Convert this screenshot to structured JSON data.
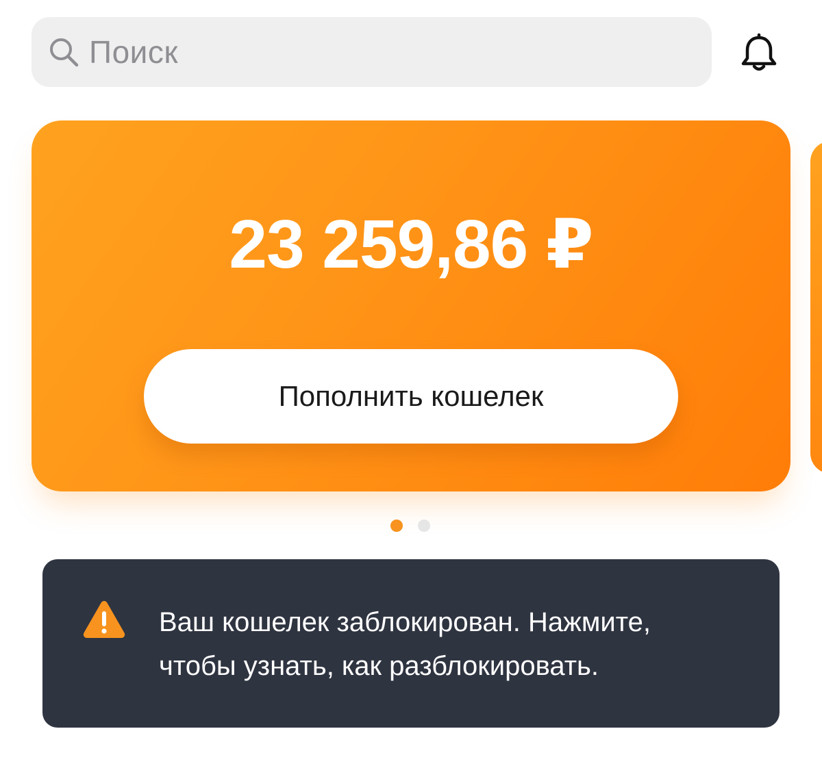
{
  "search": {
    "placeholder": "Поиск",
    "icon": "search-icon"
  },
  "header": {
    "notifications_icon": "bell-icon"
  },
  "wallet": {
    "balance": "23 259,86 ₽",
    "topup_label": "Пополнить кошелек",
    "card_color": "#ff9518"
  },
  "pagination": {
    "total": 2,
    "active_index": 0,
    "active_color": "#f7931e"
  },
  "alert": {
    "line1": "Ваш кошелек заблокирован. Нажмите,",
    "line2": "чтобы узнать, как разблокировать.",
    "icon": "warning-icon",
    "icon_color": "#f7931e",
    "background": "#2f3441"
  }
}
